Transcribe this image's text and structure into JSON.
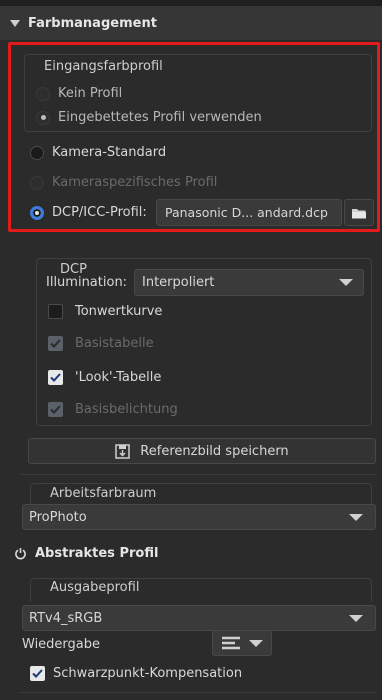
{
  "panel": {
    "title": "Farbmanagement"
  },
  "input_profile": {
    "group_label": "Eingangsfarbprofil",
    "options": [
      {
        "label": "Kein Profil",
        "state": "dim"
      },
      {
        "label": "Eingebettetes Profil verwenden",
        "state": "checked-dim"
      },
      {
        "label": "Kamera-Standard",
        "state": "off"
      },
      {
        "label": "Kameraspezifisches Profil",
        "state": "disabled"
      },
      {
        "label": "DCP/ICC-Profil:",
        "state": "selected"
      }
    ],
    "dcp_file_value": "Panasonic D... andard.dcp"
  },
  "dcp": {
    "group_label": "DCP",
    "illumination_label": "Illumination:",
    "illumination_value": "Interpoliert",
    "tone_curve_label": "Tonwertkurve",
    "base_table_label": "Basistabelle",
    "look_table_label": "'Look'-Tabelle",
    "base_exposure_label": "Basisbelichtung"
  },
  "save_reference_label": "Referenzbild speichern",
  "working_space": {
    "group_label": "Arbeitsfarbraum",
    "value": "ProPhoto"
  },
  "abstract_profile": {
    "label": "Abstraktes Profil"
  },
  "output_profile": {
    "group_label": "Ausgabeprofil",
    "value": "RTv4_sRGB",
    "intent_label": "Wiedergabe",
    "black_point_label": "Schwarzpunkt-Kompensation"
  },
  "colors": {
    "accent": "#3d7be0",
    "highlight_border": "#e31b1b",
    "background": "#2b2b2b"
  }
}
